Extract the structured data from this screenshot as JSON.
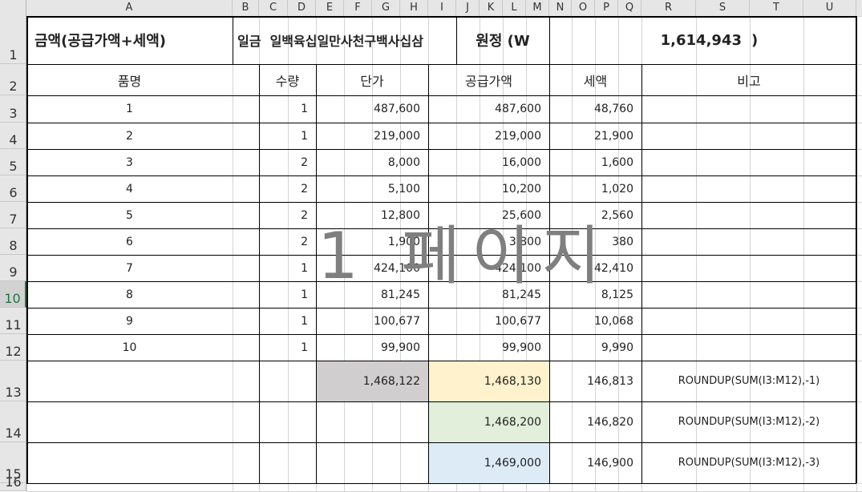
{
  "columns": [
    "A",
    "B",
    "C",
    "D",
    "E",
    "F",
    "G",
    "H",
    "I",
    "J",
    "K",
    "L",
    "M",
    "N",
    "O",
    "P",
    "Q",
    "R",
    "S",
    "T",
    "U"
  ],
  "rows": [
    "1",
    "2",
    "3",
    "4",
    "5",
    "6",
    "7",
    "8",
    "9",
    "10",
    "11",
    "12",
    "13",
    "14",
    "15",
    "16"
  ],
  "title": {
    "label": "금액(공급가액+세액)",
    "korean_words": "일금  일백육십일만사천구백사십삼",
    "won": "원정 (W",
    "amount": "1,614,943",
    "close": ")"
  },
  "headers": {
    "item": "품명",
    "qty": "수량",
    "price": "단가",
    "supply": "공급가액",
    "tax": "세액",
    "note": "비고"
  },
  "items": [
    {
      "name": "1",
      "qty": "1",
      "price": "487,600",
      "supply": "487,600",
      "tax": "48,760"
    },
    {
      "name": "2",
      "qty": "1",
      "price": "219,000",
      "supply": "219,000",
      "tax": "21,900"
    },
    {
      "name": "3",
      "qty": "2",
      "price": "8,000",
      "supply": "16,000",
      "tax": "1,600"
    },
    {
      "name": "4",
      "qty": "2",
      "price": "5,100",
      "supply": "10,200",
      "tax": "1,020"
    },
    {
      "name": "5",
      "qty": "2",
      "price": "12,800",
      "supply": "25,600",
      "tax": "2,560"
    },
    {
      "name": "6",
      "qty": "2",
      "price": "1,900",
      "supply": "3,800",
      "tax": "380"
    },
    {
      "name": "7",
      "qty": "1",
      "price": "424,100",
      "supply": "424,100",
      "tax": "42,410"
    },
    {
      "name": "8",
      "qty": "1",
      "price": "81,245",
      "supply": "81,245",
      "tax": "8,125"
    },
    {
      "name": "9",
      "qty": "1",
      "price": "100,677",
      "supply": "100,677",
      "tax": "10,068"
    },
    {
      "name": "10",
      "qty": "1",
      "price": "99,900",
      "supply": "99,900",
      "tax": "9,990"
    }
  ],
  "totals": [
    {
      "price": "1,468,122",
      "supply": "1,468,130",
      "tax": "146,813",
      "note": "ROUNDUP(SUM(I3:M12),-1)"
    },
    {
      "price": "",
      "supply": "1,468,200",
      "tax": "146,820",
      "note": "ROUNDUP(SUM(I3:M12),-2)"
    },
    {
      "price": "",
      "supply": "1,469,000",
      "tax": "146,900",
      "note": "ROUNDUP(SUM(I3:M12),-3)"
    }
  ],
  "watermark": "1 페이지",
  "active_row": "10",
  "colors": {
    "grey_fill": "#d0cece",
    "yellow_fill": "#fff2cc",
    "green_fill": "#e2efda",
    "blue_fill": "#ddebf7",
    "active_header_text": "#217346"
  }
}
